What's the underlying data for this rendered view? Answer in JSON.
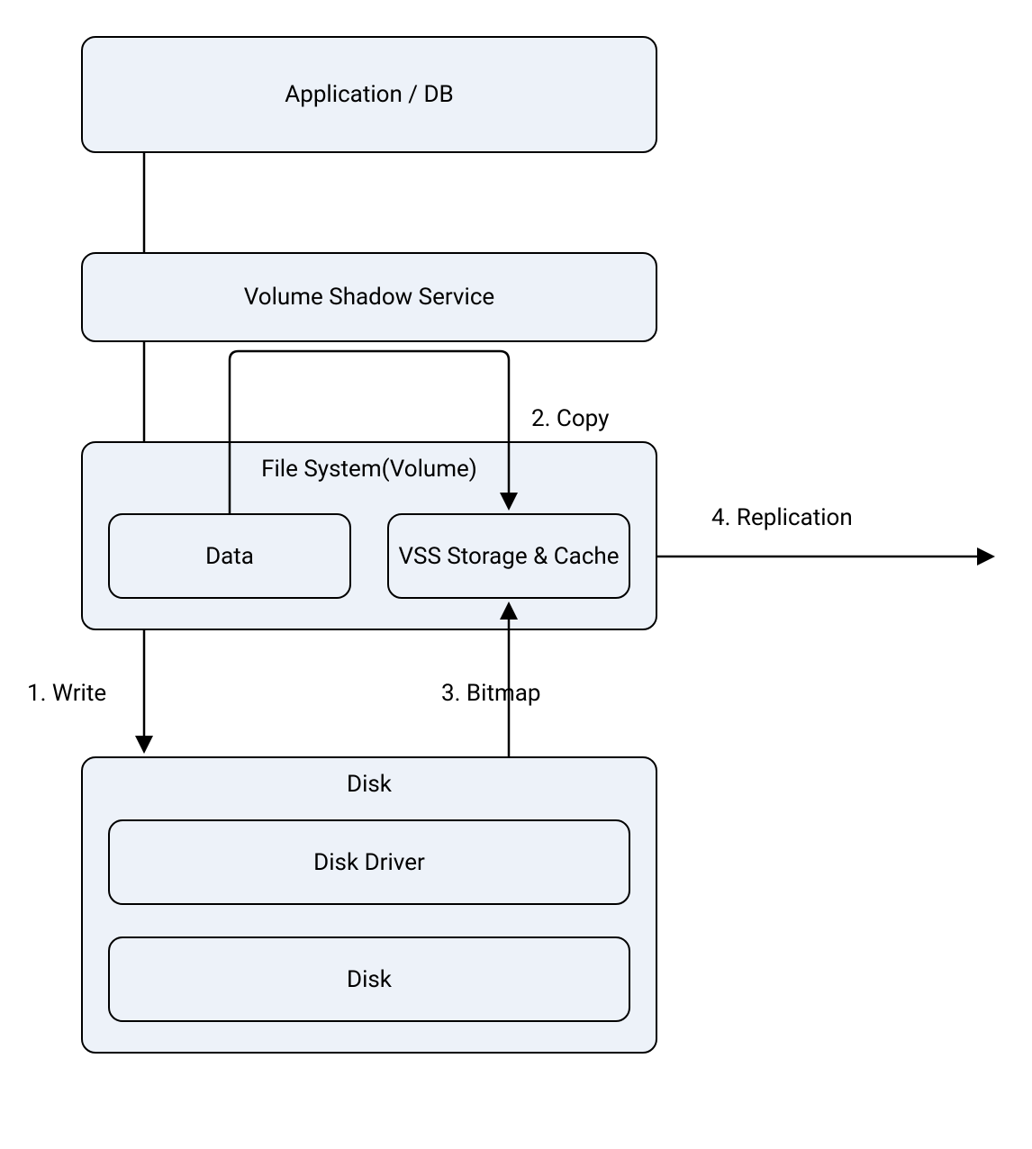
{
  "nodes": {
    "app": {
      "label": "Application / DB"
    },
    "vss": {
      "label": "Volume Shadow Service"
    },
    "fs": {
      "label": "File System(Volume)"
    },
    "data": {
      "label": "Data"
    },
    "vss_storage": {
      "label": "VSS Storage & Cache"
    },
    "disk_group": {
      "label": "Disk"
    },
    "disk_driver": {
      "label": "Disk Driver"
    },
    "disk": {
      "label": "Disk"
    }
  },
  "edges": {
    "write": {
      "label": "1. Write"
    },
    "copy": {
      "label": "2. Copy"
    },
    "bitmap": {
      "label": "3. Bitmap"
    },
    "replication": {
      "label": "4. Replication"
    }
  }
}
